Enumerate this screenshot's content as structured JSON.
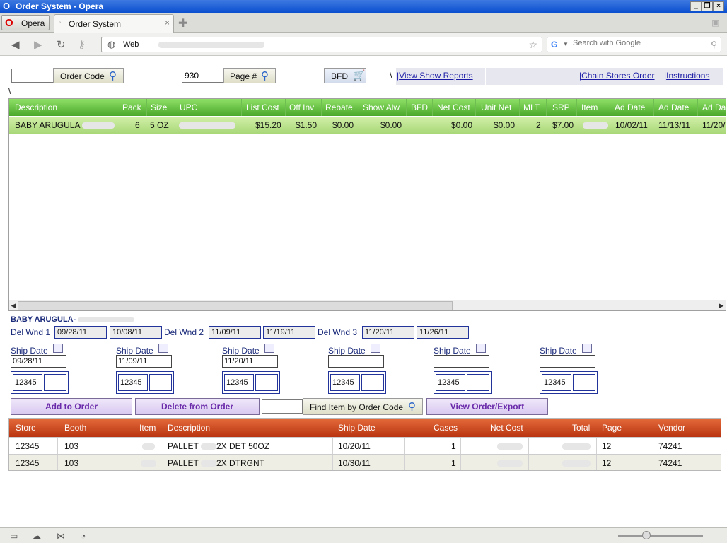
{
  "window": {
    "title": "Order System - Opera"
  },
  "browser": {
    "menu_label": "Opera",
    "tab_title": "Order System",
    "address_label": "Web",
    "search_placeholder": "Search with Google"
  },
  "toolbar": {
    "order_code_value": "",
    "order_code_button": "Order Code",
    "page_value": "930",
    "page_button": "Page #",
    "bfd_button": "BFD",
    "backslash": "\\",
    "view_show_reports": "View Show Reports",
    "chain_stores_order": "Chain Stores Order",
    "instructions": "Instructions"
  },
  "grid": {
    "columns": [
      "Description",
      "Pack",
      "Size",
      "UPC",
      "List Cost",
      "Off Inv",
      "Rebate",
      "Show Alw",
      "BFD",
      "Net Cost",
      "Unit Net",
      "MLT",
      "SRP",
      "Item",
      "Ad Date",
      "Ad Date",
      "Ad Dat"
    ],
    "row": {
      "description": "BABY ARUGULA",
      "pack": "6",
      "size": "5 OZ",
      "upc": "",
      "list_cost": "$15.20",
      "off_inv": "$1.50",
      "rebate": "$0.00",
      "show_alw": "$0.00",
      "bfd": "",
      "net_cost": "$0.00",
      "unit_net": "$0.00",
      "mlt": "2",
      "srp": "$7.00",
      "item": "",
      "ad_date_1": "10/02/11",
      "ad_date_2": "11/13/11",
      "ad_date_3": "11/20/"
    }
  },
  "detail": {
    "item_title": "BABY ARUGULA-",
    "del_windows": [
      {
        "label": "Del Wnd 1",
        "start": "09/28/11",
        "end": "10/08/11"
      },
      {
        "label": "Del Wnd 2",
        "start": "11/09/11",
        "end": "11/19/11"
      },
      {
        "label": "Del Wnd 3",
        "start": "11/20/11",
        "end": "11/26/11"
      }
    ],
    "ship_label": "Ship Date",
    "ship_dates": [
      "09/28/11",
      "11/09/11",
      "11/20/11",
      "",
      "",
      ""
    ],
    "store_values": [
      "12345",
      "12345",
      "12345",
      "12345",
      "12345",
      "12345"
    ]
  },
  "actions": {
    "add": "Add to Order",
    "delete": "Delete from Order",
    "find_value": "",
    "find": "Find Item by Order Code",
    "view": "View Order/Export"
  },
  "orders": {
    "columns": [
      "Store",
      "Booth",
      "Item",
      "Description",
      "Ship Date",
      "Cases",
      "Net Cost",
      "Total",
      "Page",
      "Vendor"
    ],
    "rows": [
      {
        "store": "12345",
        "booth": "103",
        "description": "PALLET",
        "description_tail": "2X DET 50OZ",
        "ship_date": "10/20/11",
        "cases": "1",
        "page": "12",
        "vendor": "74241"
      },
      {
        "store": "12345",
        "booth": "103",
        "description": "PALLET",
        "description_tail": "2X DTRGNT",
        "ship_date": "10/30/11",
        "cases": "1",
        "page": "12",
        "vendor": "74241"
      }
    ]
  },
  "colors": {
    "grid_header": "#4aa82a",
    "order_header": "#b83410",
    "accent": "#6a2aaa"
  }
}
